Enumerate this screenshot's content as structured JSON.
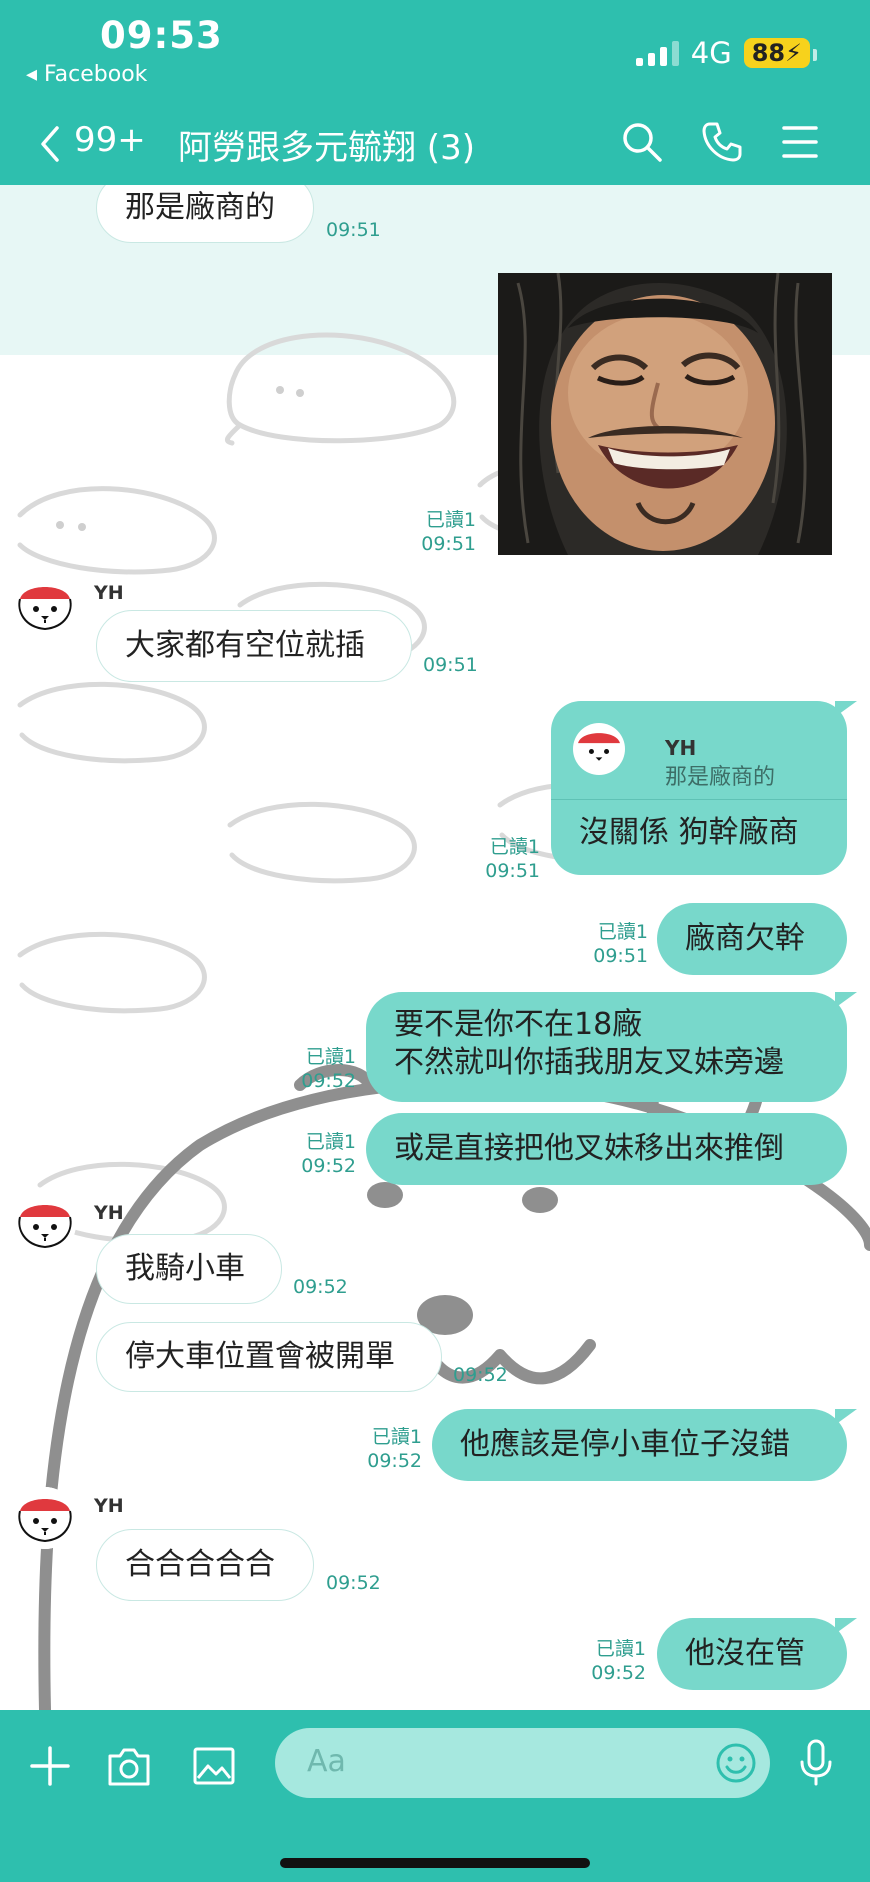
{
  "status_bar": {
    "time": "09:53",
    "back_app": "◂ Facebook",
    "network": "4G",
    "battery": "88"
  },
  "header": {
    "unread_count": "99+",
    "chat_title": "阿勞跟多元毓翔 (3)"
  },
  "messages": [
    {
      "text": "那是廠商的",
      "time": "09:51"
    },
    {
      "read": "已讀1",
      "time": "09:51"
    },
    {
      "sender": "YH",
      "text": "大家都有空位就插",
      "time": "09:51"
    },
    {
      "reply_to_sender": "YH",
      "reply_to_text": "那是廠商的",
      "text": "沒關係 狗幹廠商",
      "read": "已讀1",
      "time": "09:51"
    },
    {
      "text": "廠商欠幹",
      "read": "已讀1",
      "time": "09:51"
    },
    {
      "text_line1": "要不是你不在18廠",
      "text_line2": "不然就叫你插我朋友叉妹旁邊",
      "read": "已讀1",
      "time": "09:52"
    },
    {
      "text": "或是直接把他叉妹移出來推倒",
      "read": "已讀1",
      "time": "09:52"
    },
    {
      "sender": "YH",
      "text": "我騎小車",
      "time": "09:52"
    },
    {
      "text": "停大車位置會被開單",
      "time": "09:52"
    },
    {
      "text": "他應該是停小車位子沒錯",
      "read": "已讀1",
      "time": "09:52"
    },
    {
      "sender": "YH",
      "text": "合合合合合",
      "time": "09:52"
    },
    {
      "text": "他沒在管",
      "read": "已讀1",
      "time": "09:52"
    }
  ],
  "input": {
    "placeholder": "Aa"
  },
  "colors": {
    "accent": "#2ebfae",
    "bubble_out": "#78d8cb",
    "bubble_in": "#ffffff",
    "badge": "#f7d21c"
  }
}
